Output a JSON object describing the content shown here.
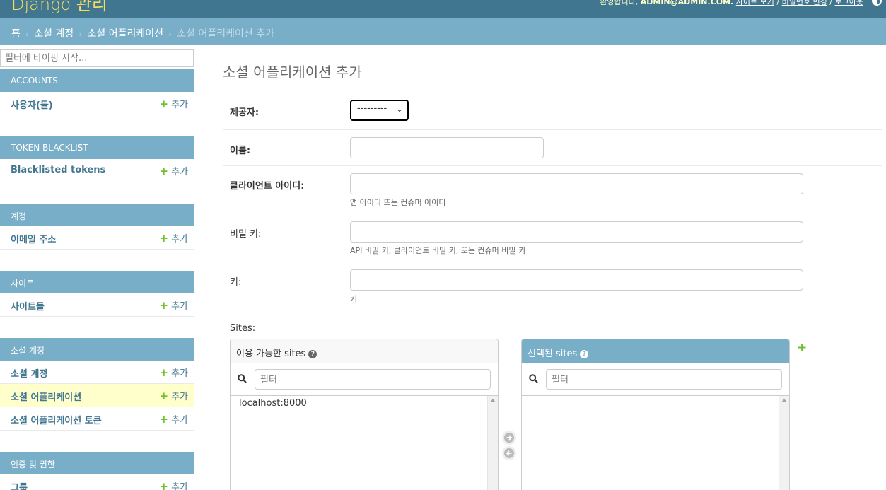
{
  "header": {
    "branding": "Django 관리",
    "welcome": "환영합니다,",
    "user": "ADMIN@ADMIN.COM.",
    "links": [
      "사이트 보기",
      "비밀번호 변경",
      "로그아웃"
    ],
    "separator": "/"
  },
  "breadcrumbs": {
    "items": [
      "홈",
      "소셜 계정",
      "소셜 어플리케이션",
      "소셜 어플리케이션 추가"
    ],
    "separator": "›"
  },
  "sidebar": {
    "filter_placeholder": "필터에 타이핑 시작...",
    "add_label": "추가",
    "modules": [
      {
        "caption": "ACCOUNTS",
        "models": [
          "사용자(들)"
        ]
      },
      {
        "caption": "TOKEN BLACKLIST",
        "models": [
          "Blacklisted tokens"
        ]
      },
      {
        "caption": "계정",
        "models": [
          "이메일 주소"
        ]
      },
      {
        "caption": "사이트",
        "models": [
          "사이트들"
        ]
      },
      {
        "caption": "소셜 계정",
        "models": [
          "소셜 계정",
          "소셜 어플리케이션",
          "소셜 어플리케이션 토큰"
        ]
      },
      {
        "caption": "인증 및 권한",
        "models": [
          "그룹"
        ]
      }
    ],
    "current_model": "소셜 어플리케이션"
  },
  "form": {
    "title": "소셜 어플리케이션 추가",
    "provider": {
      "label": "제공자:",
      "value": "---------"
    },
    "name": {
      "label": "이름:",
      "value": ""
    },
    "client_id": {
      "label": "클라이언트 아이디:",
      "value": "",
      "help": "앱 아이디 또는 컨슈머 아이디"
    },
    "secret": {
      "label": "비밀 키:",
      "value": "",
      "help": "API 비밀 키, 클라이언트 비밀 키, 또는 컨슈머 비밀 키"
    },
    "key": {
      "label": "키:",
      "value": "",
      "help": "키"
    },
    "sites": {
      "label": "Sites:",
      "available_title": "이용 가능한 sites",
      "chosen_title": "선택된 sites",
      "filter_placeholder": "필터",
      "available_options": [
        "localhost:8000"
      ],
      "chosen_options": []
    }
  },
  "colors": {
    "header": "#417690",
    "breadcrumbs": "#79aec8",
    "branding": "#f5dd5d",
    "add_plus": "#70bf2b",
    "current_row": "#ffffcc"
  }
}
